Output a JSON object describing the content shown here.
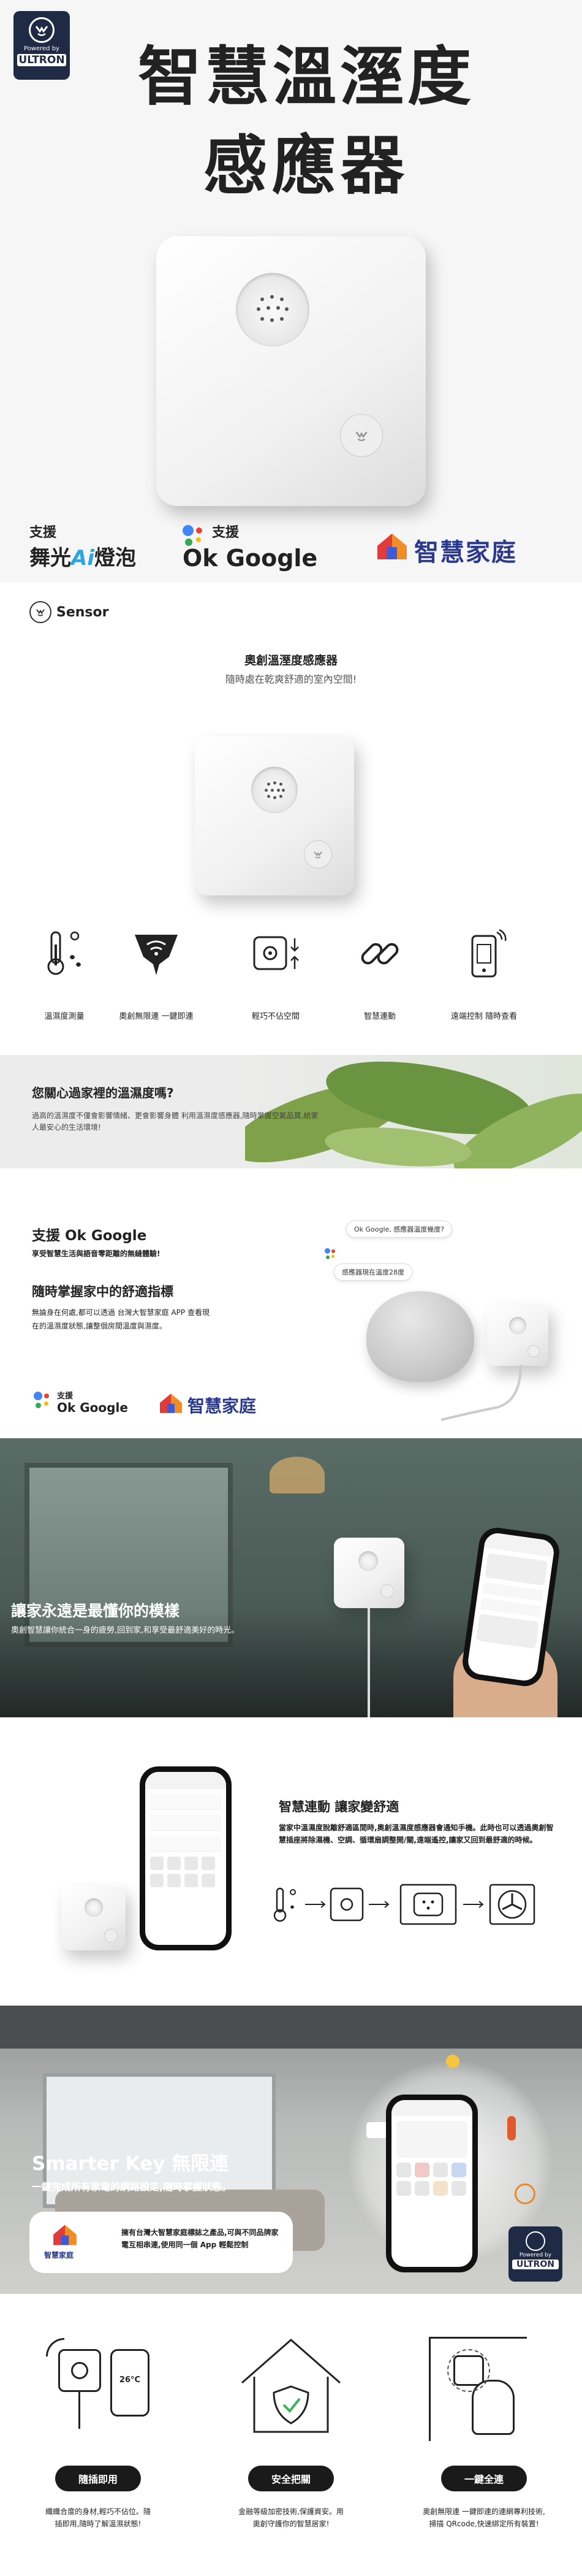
{
  "hero": {
    "brand_powered": "Powered by",
    "brand_name": "ULTRON",
    "title_line1": "智慧溫溼度",
    "title_line2": "感應器",
    "support_prefix": "支援",
    "support_lamp_a": "舞光",
    "support_lamp_ai": "Ai",
    "support_lamp_b": "燈泡",
    "support_google_prefix": "支援",
    "support_google": "Ok Google",
    "smart_home": "智慧家庭"
  },
  "intro": {
    "sensor_logo_text": "Sensor",
    "heading": "奧創溫溼度感應器",
    "subheading": "隨時處在乾爽舒適的室內空間!",
    "features": [
      {
        "icon": "thermometer-icon",
        "label": "溫濕度測量"
      },
      {
        "icon": "wifi-icon",
        "label": "奧創無限連 一鍵即連"
      },
      {
        "icon": "device-icon",
        "label": "輕巧不佔空間"
      },
      {
        "icon": "link-icon",
        "label": "智慧連動"
      },
      {
        "icon": "remote-icon",
        "label": "遠端控制 隨時查看"
      }
    ]
  },
  "care": {
    "title": "您關心過家裡的溫濕度嗎?",
    "body": "過高的溫濕度不僅會影響情緒、更會影響身體 利用溫濕度感應器,隨時掌握空氣品質,給家人最安心的生活環境!"
  },
  "google": {
    "title": "支援 Ok Google",
    "subtitle": "享受智慧生活與語音零距離的無縫體驗!",
    "title2": "隨時掌握家中的舒適指標",
    "body2": "無論身在何處,都可以透過 台灣大智慧家庭 APP 查看現在的溫濕度狀態,讓整個房間溫度與濕度。",
    "bubble_q": "Ok Google, 感應器溫度幾度?",
    "bubble_a": "感應器現在溫度28度",
    "logo_prefix": "支援",
    "logo_google": "Ok Google",
    "logo_smart": "智慧家庭"
  },
  "room": {
    "title": "讓家永遠是最懂你的模樣",
    "body": "奧創智慧讓你統合一身的疲勞,回到家,和享受最舒適美好的時光。"
  },
  "linkage": {
    "title": "智慧連動 讓家變舒適",
    "body": "當家中溫濕度脫離舒適區間時,奧創溫濕度感應器會通知手機。此時也可以透過奧創智慧插座將除濕機、空調、循環扇調整開/關,遠端遙控,讓家又回到最舒適的時候。"
  },
  "smartkey": {
    "title": "Smarter Key 無限連",
    "subtitle": "一鍵完成所有家電的網路設定,隨時掌握狀態。",
    "box_label": "智慧家庭",
    "box_text": "擁有台灣大智慧家庭標誌之產品,可與不同品牌家電互相串連,使用同一個 App 輕鬆控制",
    "logo_powered": "Powered by",
    "logo_name": "ULTRON"
  },
  "bottom": {
    "temp_reading": "26°C",
    "items": [
      {
        "badge": "隨插即用",
        "text": "纖纖合度的身材,輕巧不佔位。隨插即用,隨時了解溫濕狀態!"
      },
      {
        "badge": "安全把關",
        "text": "金融等級加密技術,保護資安。用奧創守護你的智慧居家!"
      },
      {
        "badge": "一鍵全連",
        "text": "奧創無限連 一鍵即連的連網專利技術, 掃描 QRcode,快速綁定所有裝置!"
      }
    ]
  }
}
